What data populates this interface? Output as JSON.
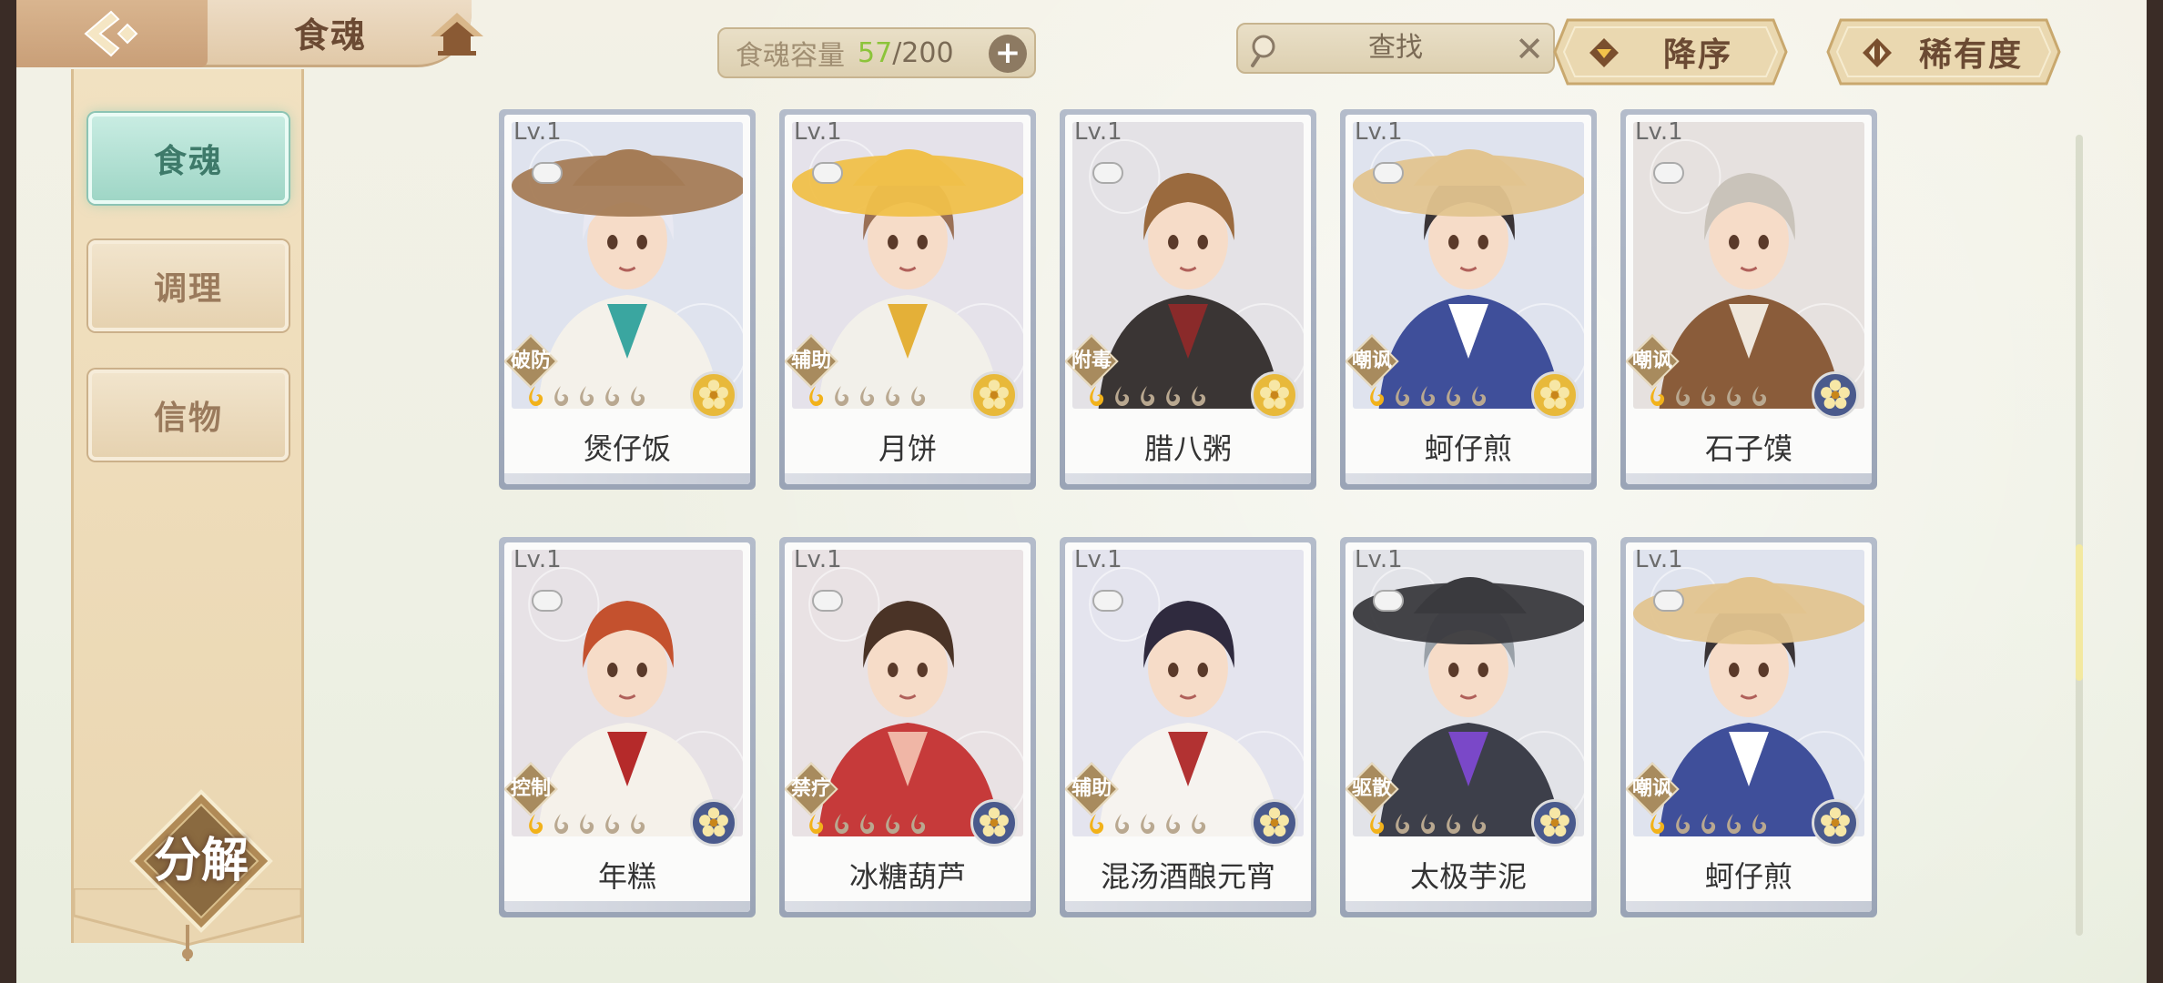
{
  "header": {
    "title": "食魂",
    "capacity": {
      "label": "食魂容量",
      "current": "57",
      "max": "/200"
    },
    "search": {
      "label": "查找"
    },
    "sort_order_label": "降序",
    "sort_by_label": "稀有度"
  },
  "sidebar": {
    "tabs": [
      {
        "label": "食魂",
        "active": true
      },
      {
        "label": "调理",
        "active": false
      },
      {
        "label": "信物",
        "active": false
      }
    ],
    "decompose_label": "分解"
  },
  "cards": [
    {
      "level": "Lv.1",
      "role": "破防",
      "name": "煲仔饭",
      "stars": 1,
      "rarity": "gold",
      "bg": "#dfe3ee",
      "hair": "#e9e9f2",
      "cloth": "#f4f1ea",
      "accent": "#3aa6a0",
      "hat": "#a57c56"
    },
    {
      "level": "Lv.1",
      "role": "辅助",
      "name": "月饼",
      "stars": 1,
      "rarity": "gold",
      "bg": "#e5e2ea",
      "hair": "#9a7056",
      "cloth": "#f2f0ea",
      "accent": "#e4b038",
      "hat": "#f0c04a"
    },
    {
      "level": "Lv.1",
      "role": "附毒",
      "name": "腊八粥",
      "stars": 1,
      "rarity": "gold",
      "bg": "#e4e2e6",
      "hair": "#9a6a3e",
      "cloth": "#3a3534",
      "accent": "#8a2a2a",
      "hat": ""
    },
    {
      "level": "Lv.1",
      "role": "嘲讽",
      "name": "蚵仔煎",
      "stars": 1,
      "rarity": "gold",
      "bg": "#dfe3ee",
      "hair": "#3a3436",
      "cloth": "#3f4f9a",
      "accent": "#ffffff",
      "hat": "#e2c48f"
    },
    {
      "level": "Lv.1",
      "role": "嘲讽",
      "name": "石子馍",
      "stars": 1,
      "rarity": "blue",
      "bg": "#e6e1df",
      "hair": "#c9c3ba",
      "cloth": "#8a5c3a",
      "accent": "#efe7dc",
      "hat": ""
    },
    {
      "level": "Lv.1",
      "role": "控制",
      "name": "年糕",
      "stars": 1,
      "rarity": "blue",
      "bg": "#e7e2e6",
      "hair": "#c4512e",
      "cloth": "#f5f1ea",
      "accent": "#b52a2a",
      "hat": ""
    },
    {
      "level": "Lv.1",
      "role": "禁疗",
      "name": "冰糖葫芦",
      "stars": 1,
      "rarity": "blue",
      "bg": "#e9e2e4",
      "hair": "#4a3326",
      "cloth": "#c63a3a",
      "accent": "#f0b6a6",
      "hat": ""
    },
    {
      "level": "Lv.1",
      "role": "辅助",
      "name": "混汤酒酿元宵",
      "stars": 1,
      "rarity": "blue",
      "bg": "#e4e4ee",
      "hair": "#2f2a3e",
      "cloth": "#f6f3ef",
      "accent": "#b23232",
      "hat": ""
    },
    {
      "level": "Lv.1",
      "role": "驱散",
      "name": "太极芋泥",
      "stars": 1,
      "rarity": "blue",
      "bg": "#e2e3e8",
      "hair": "#9aa1a8",
      "cloth": "#3d3f4a",
      "accent": "#7a48c8",
      "hat": "#3a3a3e"
    },
    {
      "level": "Lv.1",
      "role": "嘲讽",
      "name": "蚵仔煎",
      "stars": 1,
      "rarity": "blue",
      "bg": "#dfe3ee",
      "hair": "#3a3436",
      "cloth": "#3f4f9a",
      "accent": "#ffffff",
      "hat": "#e2c48f"
    }
  ],
  "colors": {
    "star_active": "#f2b21a",
    "star_inactive": "#b9a890",
    "rarity_gold": "#e8b93a",
    "rarity_blue": "#4a5a8c"
  }
}
